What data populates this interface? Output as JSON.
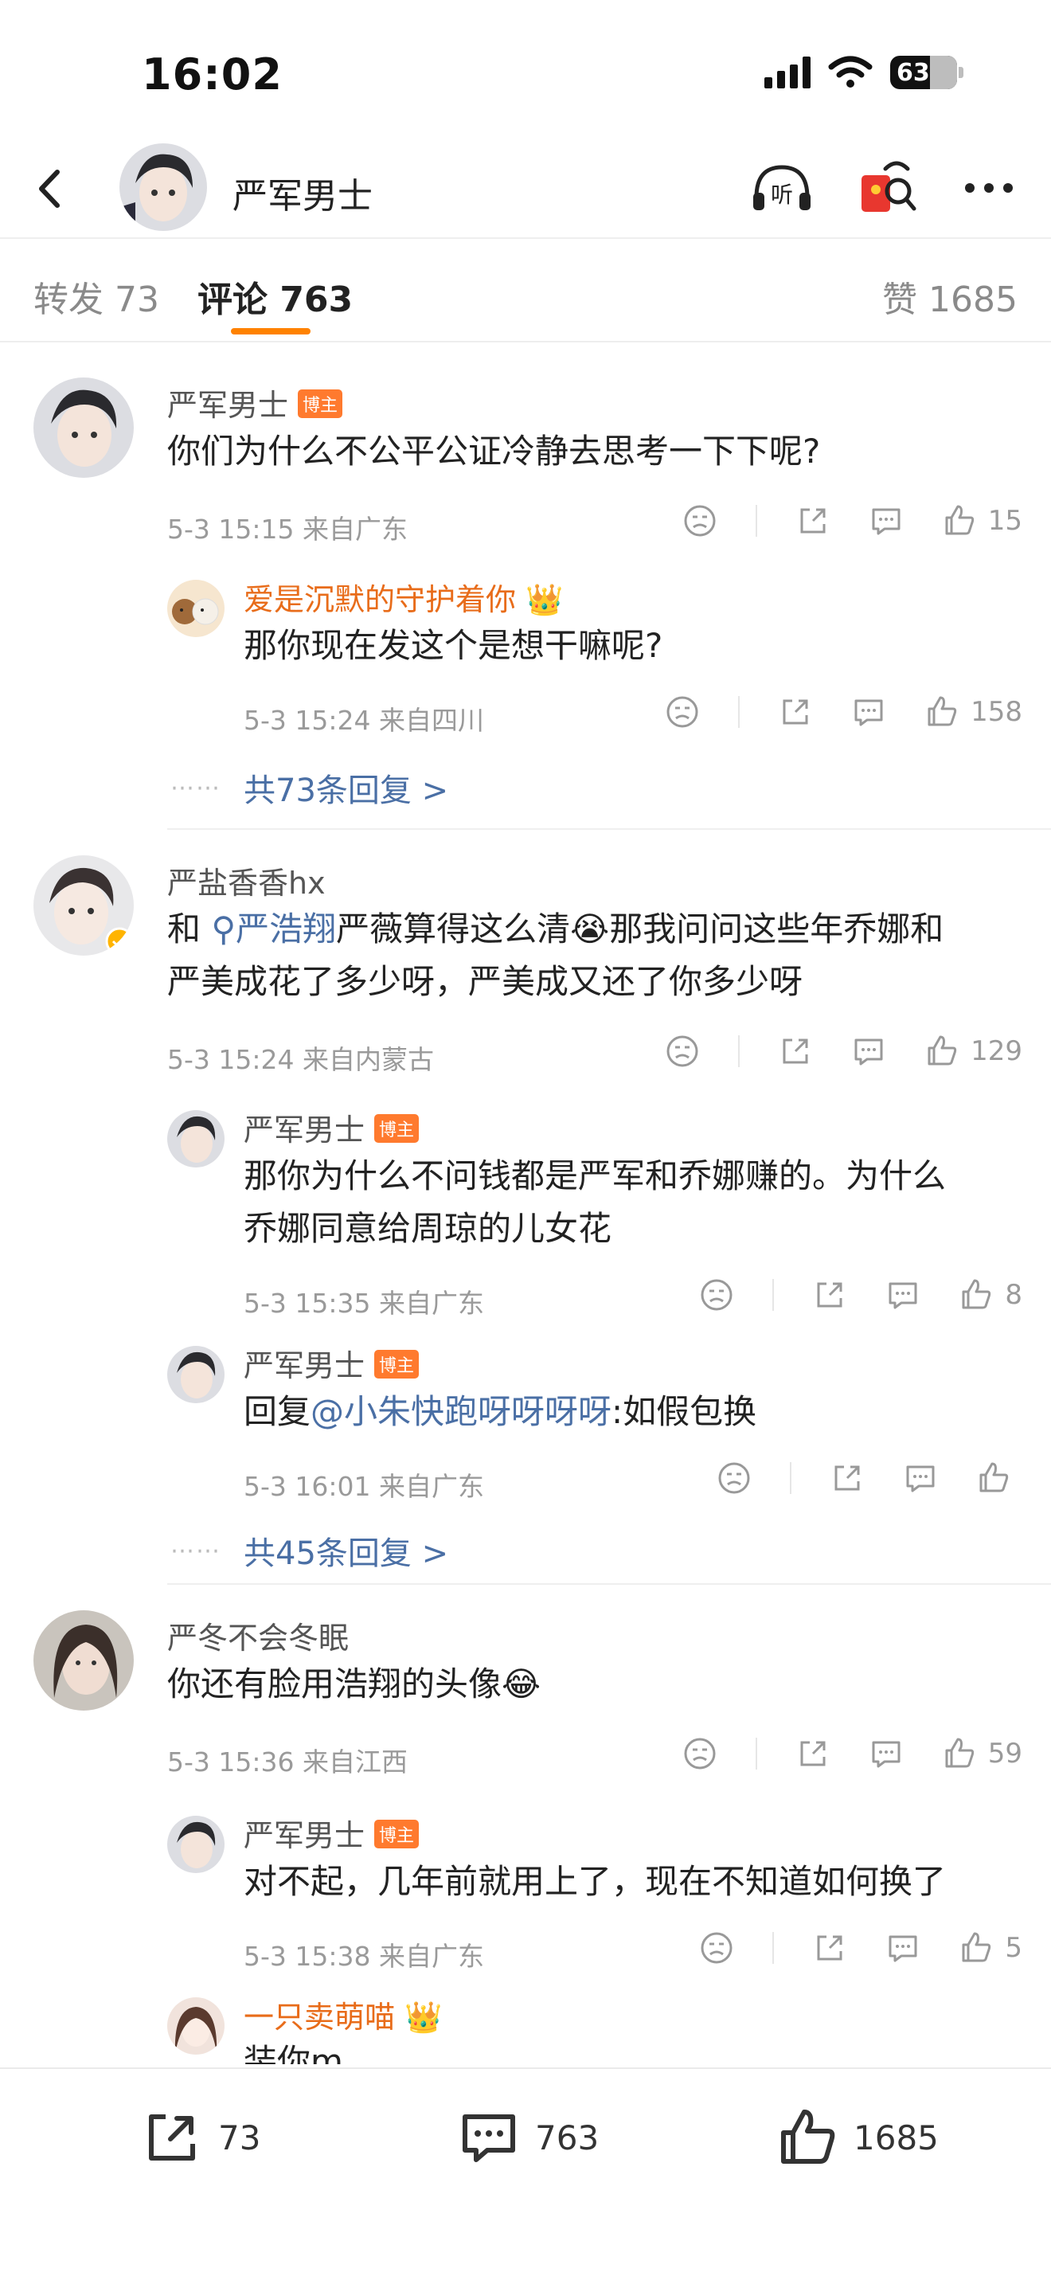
{
  "status_bar": {
    "time": "16:02",
    "battery": "63"
  },
  "header": {
    "title": "严军男士",
    "listen_label": "听"
  },
  "tabs": {
    "repost": "转发 73",
    "comments": "评论 763",
    "likes": "赞 1685",
    "accent_color": "#ff8200"
  },
  "comments": [
    {
      "user": "严军男士",
      "badge": "博主",
      "text": "你们为什么不公平公证冷静去思考一下下呢?",
      "meta": "5-3 15:15  来自广东",
      "likes": "15",
      "replies": [
        {
          "user": "爱是沉默的守护着你",
          "text": "那你现在发这个是想干嘛呢?",
          "meta": "5-3 15:24  来自四川",
          "likes": "158"
        }
      ],
      "more_replies": "共73条回复 >"
    },
    {
      "user": "严盐香香hx",
      "text_prefix": "和",
      "text_link": "严浩翔",
      "text_line1_rest": "严薇算得这么清😭那我问问这些年乔娜和",
      "text_line2": "严美成花了多少呀，严美成又还了你多少呀",
      "meta": "5-3 15:24  来自内蒙古",
      "likes": "129",
      "replies": [
        {
          "user": "严军男士",
          "badge": "博主",
          "text_line1": "那你为什么不问钱都是严军和乔娜赚的。为什么",
          "text_line2": "乔娜同意给周琼的儿女花",
          "meta": "5-3 15:35  来自广东",
          "likes": "8"
        },
        {
          "user": "严军男士",
          "badge": "博主",
          "text_prefix": "回复",
          "text_link": "@小朱快跑呀呀呀呀",
          "text_rest": ":如假包换",
          "meta": "5-3 16:01  来自广东",
          "likes": ""
        }
      ],
      "more_replies": "共45条回复 >"
    },
    {
      "user": "严冬不会冬眠",
      "text": "你还有脸用浩翔的头像😂",
      "meta": "5-3 15:36  来自江西",
      "likes": "59",
      "replies": [
        {
          "user": "严军男士",
          "badge": "博主",
          "text": "对不起，几年前就用上了，现在不知道如何换了",
          "meta": "5-3 15:38  来自广东",
          "likes": "5"
        },
        {
          "user": "一只卖萌喵",
          "text": "装你m"
        }
      ]
    }
  ],
  "more_dots": "⋯⋯",
  "bottom_bar": {
    "reposts": "73",
    "comments": "763",
    "likes": "1685"
  }
}
